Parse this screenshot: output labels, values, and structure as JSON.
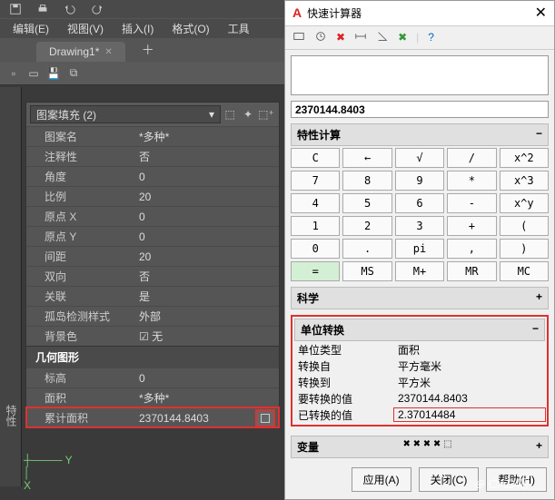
{
  "menubar": [
    "编辑(E)",
    "视图(V)",
    "插入(I)",
    "格式(O)",
    "工具"
  ],
  "tab": {
    "name": "Drawing1*",
    "star": "*"
  },
  "props": {
    "combo": "图案填充 (2)",
    "rows": [
      {
        "l": "图案名",
        "v": "*多种*"
      },
      {
        "l": "注释性",
        "v": "否"
      },
      {
        "l": "角度",
        "v": "0"
      },
      {
        "l": "比例",
        "v": "20"
      },
      {
        "l": "原点 X",
        "v": "0"
      },
      {
        "l": "原点 Y",
        "v": "0"
      },
      {
        "l": "间距",
        "v": "20"
      },
      {
        "l": "双向",
        "v": "否"
      },
      {
        "l": "关联",
        "v": "是"
      },
      {
        "l": "孤岛检测样式",
        "v": "外部"
      },
      {
        "l": "背景色",
        "v": "☑ 无"
      }
    ],
    "sect2": "几何图形",
    "rows2": [
      {
        "l": "标高",
        "v": "0"
      },
      {
        "l": "面积",
        "v": "*多种*"
      },
      {
        "l": "累计面积",
        "v": "2370144.8403",
        "btn": true
      }
    ]
  },
  "side_label": "特性",
  "calc": {
    "title": "快速计算器",
    "result": "2370144.8403",
    "sects": {
      "props": "特性计算",
      "sci": "科学",
      "unit": "单位转换",
      "var": "变量"
    },
    "keys": [
      [
        "C",
        "←",
        "√",
        "/",
        "x^2"
      ],
      [
        "7",
        "8",
        "9",
        "*",
        "x^3"
      ],
      [
        "4",
        "5",
        "6",
        "-",
        "x^y"
      ],
      [
        "1",
        "2",
        "3",
        "+",
        "("
      ],
      [
        "0",
        ".",
        "pi",
        ",",
        ")"
      ],
      [
        "=",
        "MS",
        "M+",
        "MR",
        "MC"
      ]
    ],
    "unit": [
      {
        "l": "单位类型",
        "v": "面积"
      },
      {
        "l": "转换自",
        "v": "平方毫米"
      },
      {
        "l": "转换到",
        "v": "平方米"
      },
      {
        "l": "要转换的值",
        "v": "2370144.8403"
      },
      {
        "l": "已转换的值",
        "v": "2.37014484",
        "hl": true
      }
    ],
    "btns": [
      "应用(A)",
      "关闭(C)",
      "帮助(H)"
    ]
  },
  "watermark": "⊕ CAD吧"
}
